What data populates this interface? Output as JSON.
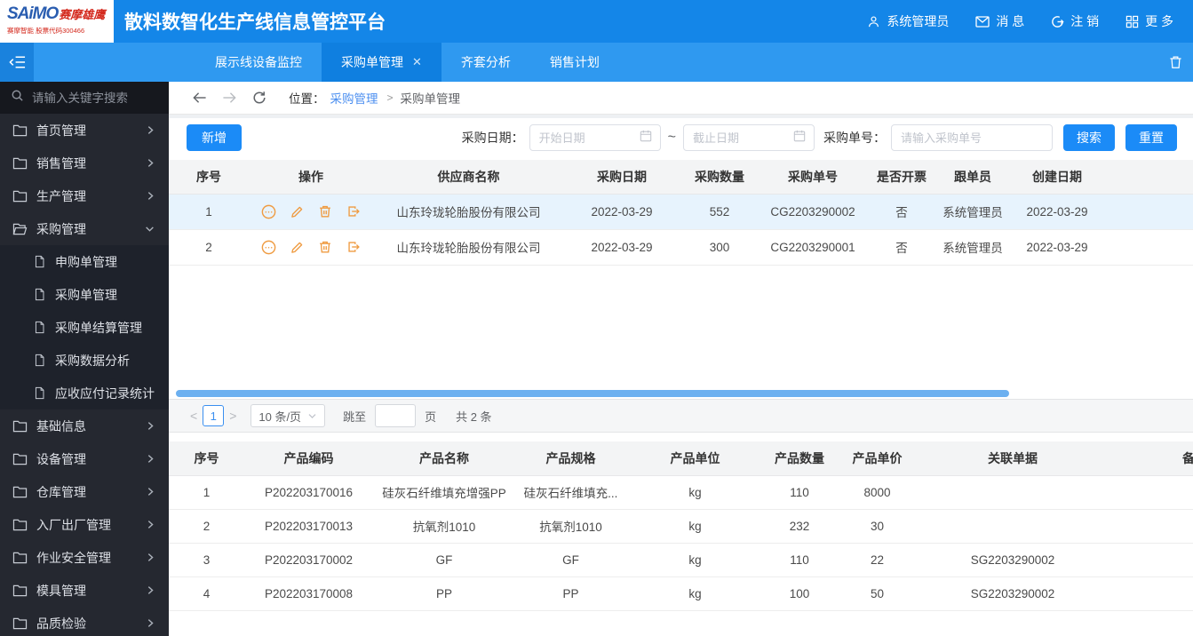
{
  "topbar": {
    "logo_brand": "SAiMO",
    "logo_brand_cn": "赛摩雄鹰",
    "logo_subtitle": "赛摩智能 股票代码300466",
    "title": "散料数智化生产线信息管控平台",
    "user": "系统管理员",
    "messages": "消 息",
    "logout": "注 销",
    "more": "更 多"
  },
  "tabbar": {
    "tabs": [
      {
        "label": "展示线设备监控"
      },
      {
        "label": "采购单管理",
        "close": "✕",
        "active": true
      },
      {
        "label": "齐套分析"
      },
      {
        "label": "销售计划"
      }
    ]
  },
  "sidebar": {
    "search_placeholder": "请输入关键字搜索",
    "items": [
      {
        "label": "首页管理"
      },
      {
        "label": "销售管理"
      },
      {
        "label": "生产管理"
      },
      {
        "label": "采购管理",
        "expanded": true
      },
      {
        "label": "基础信息"
      },
      {
        "label": "设备管理"
      },
      {
        "label": "仓库管理"
      },
      {
        "label": "入厂出厂管理"
      },
      {
        "label": "作业安全管理"
      },
      {
        "label": "模具管理"
      },
      {
        "label": "品质检验"
      }
    ],
    "purchase_children": [
      "申购单管理",
      "采购单管理",
      "采购单结算管理",
      "采购数据分析",
      "应收应付记录统计"
    ]
  },
  "breadcrumb": {
    "label": "位置：",
    "parent": "采购管理",
    "separator": ">",
    "current": "采购单管理"
  },
  "toolbar": {
    "add_label": "新增",
    "date_label": "采购日期：",
    "start_placeholder": "开始日期",
    "range_separator": "~",
    "end_placeholder": "截止日期",
    "order_label": "采购单号：",
    "order_placeholder": "请输入采购单号",
    "search_label": "搜索",
    "reset_label": "重置"
  },
  "main_table": {
    "columns": [
      "序号",
      "操作",
      "供应商名称",
      "采购日期",
      "采购数量",
      "采购单号",
      "是否开票",
      "跟单员",
      "创建日期"
    ],
    "action_icons": [
      "comment-icon",
      "edit-icon",
      "delete-icon",
      "export-icon"
    ],
    "rows": [
      {
        "seq": "1",
        "supplier": "山东玲珑轮胎股份有限公司",
        "date": "2022-03-29",
        "qty": "552",
        "order_no": "CG2203290002",
        "invoiced": "否",
        "tracker": "系统管理员",
        "created": "2022-03-29",
        "selected": true
      },
      {
        "seq": "2",
        "supplier": "山东玲珑轮胎股份有限公司",
        "date": "2022-03-29",
        "qty": "300",
        "order_no": "CG2203290001",
        "invoiced": "否",
        "tracker": "系统管理员",
        "created": "2022-03-29",
        "selected": false
      }
    ]
  },
  "pagination": {
    "prev": "<",
    "page": "1",
    "next": ">",
    "page_size": "10 条/页",
    "jump_label": "跳至",
    "page_unit": "页",
    "total": "共 2 条"
  },
  "detail_table": {
    "columns": [
      "序号",
      "产品编码",
      "产品名称",
      "产品规格",
      "产品单位",
      "产品数量",
      "产品单价",
      "关联单据",
      "备注"
    ],
    "rows": [
      {
        "seq": "1",
        "code": "P202203170016",
        "name": "硅灰石纤维填充增强PP",
        "spec": "硅灰石纤维填充...",
        "unit": "kg",
        "qty": "110",
        "price": "8000",
        "related": "",
        "remark": ""
      },
      {
        "seq": "2",
        "code": "P202203170013",
        "name": "抗氧剂1010",
        "spec": "抗氧剂1010",
        "unit": "kg",
        "qty": "232",
        "price": "30",
        "related": "",
        "remark": ""
      },
      {
        "seq": "3",
        "code": "P202203170002",
        "name": "GF",
        "spec": "GF",
        "unit": "kg",
        "qty": "110",
        "price": "22",
        "related": "SG2203290002",
        "remark": ""
      },
      {
        "seq": "4",
        "code": "P202203170008",
        "name": "PP",
        "spec": "PP",
        "unit": "kg",
        "qty": "100",
        "price": "50",
        "related": "SG2203290002",
        "remark": ""
      }
    ]
  },
  "colors": {
    "header_blue": "#1486e8",
    "tabbar_blue": "#2f99f0",
    "active_tab_blue": "#0f7fe0",
    "accent_blue": "#1b8bf7",
    "link_blue": "#4a8ef0",
    "sidebar_bg": "#252830",
    "selected_row": "#e7f3fd",
    "action_orange": "#ef9b41",
    "scrollbar_blue": "#6cb0f0"
  }
}
